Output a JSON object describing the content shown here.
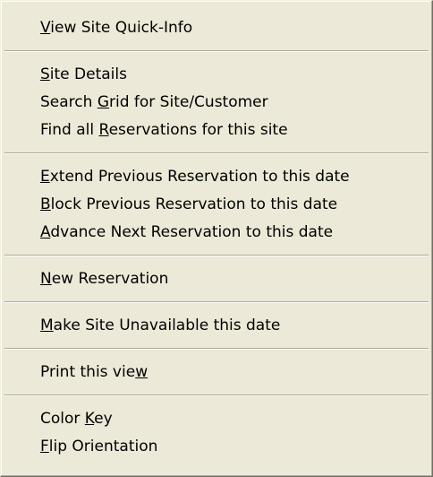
{
  "menu": {
    "groups": [
      [
        {
          "name": "view-site-quick-info",
          "pre": "",
          "mn": "V",
          "post": "iew Site Quick-Info"
        }
      ],
      [
        {
          "name": "site-details",
          "pre": "",
          "mn": "S",
          "post": "ite Details"
        },
        {
          "name": "search-grid-for-site-customer",
          "pre": "Search ",
          "mn": "G",
          "post": "rid for Site/Customer"
        },
        {
          "name": "find-all-reservations",
          "pre": "Find all ",
          "mn": "R",
          "post": "eservations for this site"
        }
      ],
      [
        {
          "name": "extend-previous-reservation",
          "pre": "",
          "mn": "E",
          "post": "xtend Previous Reservation to this date"
        },
        {
          "name": "block-previous-reservation",
          "pre": "",
          "mn": "B",
          "post": "lock Previous Reservation to this date"
        },
        {
          "name": "advance-next-reservation",
          "pre": "",
          "mn": "A",
          "post": "dvance Next Reservation to this date"
        }
      ],
      [
        {
          "name": "new-reservation",
          "pre": "",
          "mn": "N",
          "post": "ew Reservation"
        }
      ],
      [
        {
          "name": "make-site-unavailable",
          "pre": "",
          "mn": "M",
          "post": "ake Site Unavailable this date"
        }
      ],
      [
        {
          "name": "print-this-view",
          "pre": "Print this vie",
          "mn": "w",
          "post": ""
        }
      ],
      [
        {
          "name": "color-key",
          "pre": "Color ",
          "mn": "K",
          "post": "ey"
        },
        {
          "name": "flip-orientation",
          "pre": "",
          "mn": "F",
          "post": "lip Orientation"
        }
      ]
    ]
  }
}
